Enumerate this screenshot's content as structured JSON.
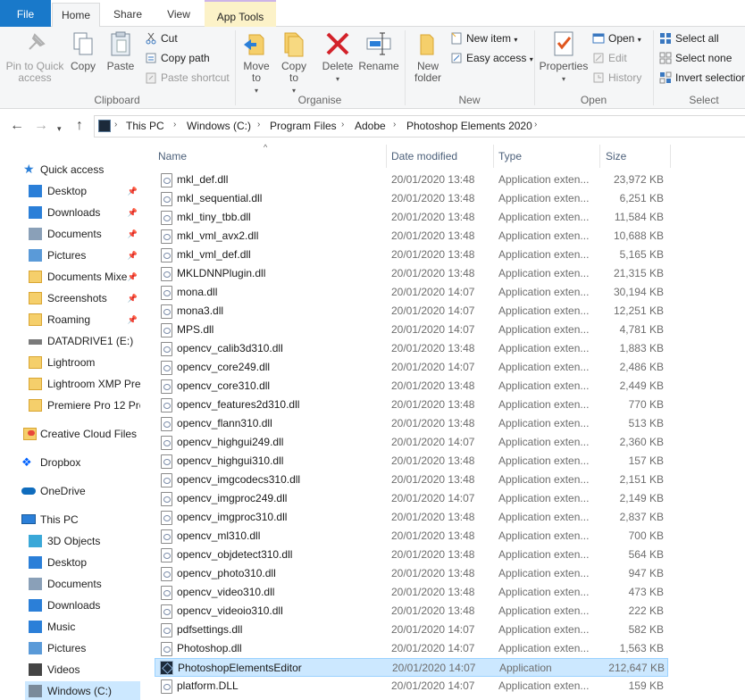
{
  "tabs": {
    "file": "File",
    "home": "Home",
    "share": "Share",
    "view": "View",
    "app_tools": "App Tools"
  },
  "ribbon": {
    "clipboard": {
      "label": "Clipboard",
      "pin": "Pin to Quick access",
      "copy": "Copy",
      "paste": "Paste",
      "cut": "Cut",
      "copy_path": "Copy path",
      "paste_shortcut": "Paste shortcut"
    },
    "organise": {
      "label": "Organise",
      "move_to": "Move to",
      "copy_to": "Copy to",
      "delete": "Delete",
      "rename": "Rename"
    },
    "new": {
      "label": "New",
      "new_folder": "New folder",
      "new_item": "New item",
      "easy_access": "Easy access"
    },
    "open": {
      "label": "Open",
      "properties": "Properties",
      "open": "Open",
      "edit": "Edit",
      "history": "History"
    },
    "select": {
      "label": "Select",
      "select_all": "Select all",
      "select_none": "Select none",
      "invert": "Invert selection"
    }
  },
  "breadcrumb": [
    "This PC",
    "Windows (C:)",
    "Program Files",
    "Adobe",
    "Photoshop Elements 2020"
  ],
  "sidebar": {
    "quick_access": "Quick access",
    "items": [
      {
        "label": "Desktop",
        "icon": "desktop-icon",
        "pinned": true
      },
      {
        "label": "Downloads",
        "icon": "downloads-icon",
        "pinned": true
      },
      {
        "label": "Documents",
        "icon": "documents-icon",
        "pinned": true
      },
      {
        "label": "Pictures",
        "icon": "pictures-icon",
        "pinned": true
      },
      {
        "label": "Documents Mixe",
        "icon": "folder-icon",
        "pinned": true
      },
      {
        "label": "Screenshots",
        "icon": "folder-icon",
        "pinned": true
      },
      {
        "label": "Roaming",
        "icon": "folder-icon",
        "pinned": true
      },
      {
        "label": "DATADRIVE1 (E:)",
        "icon": "drive-icon",
        "pinned": false
      },
      {
        "label": "Lightroom",
        "icon": "folder-icon",
        "pinned": false
      },
      {
        "label": "Lightroom XMP Pre",
        "icon": "folder-icon",
        "pinned": false
      },
      {
        "label": "Premiere Pro 12 Pro",
        "icon": "folder-icon",
        "pinned": false
      }
    ],
    "creative_cloud": "Creative Cloud Files",
    "dropbox": "Dropbox",
    "onedrive": "OneDrive",
    "this_pc": "This PC",
    "pc_items": [
      {
        "label": "3D Objects",
        "icon": "3d-objects-icon"
      },
      {
        "label": "Desktop",
        "icon": "desktop-icon"
      },
      {
        "label": "Documents",
        "icon": "documents-icon"
      },
      {
        "label": "Downloads",
        "icon": "downloads-icon"
      },
      {
        "label": "Music",
        "icon": "music-icon"
      },
      {
        "label": "Pictures",
        "icon": "pictures-icon"
      },
      {
        "label": "Videos",
        "icon": "videos-icon"
      },
      {
        "label": "Windows (C:)",
        "icon": "windows-drive-icon"
      }
    ]
  },
  "columns": {
    "name": "Name",
    "date": "Date modified",
    "type": "Type",
    "size": "Size"
  },
  "files": [
    {
      "name": "mkl_def.dll",
      "date": "20/01/2020 13:48",
      "type": "Application exten...",
      "size": "23,972 KB"
    },
    {
      "name": "mkl_sequential.dll",
      "date": "20/01/2020 13:48",
      "type": "Application exten...",
      "size": "6,251 KB"
    },
    {
      "name": "mkl_tiny_tbb.dll",
      "date": "20/01/2020 13:48",
      "type": "Application exten...",
      "size": "11,584 KB"
    },
    {
      "name": "mkl_vml_avx2.dll",
      "date": "20/01/2020 13:48",
      "type": "Application exten...",
      "size": "10,688 KB"
    },
    {
      "name": "mkl_vml_def.dll",
      "date": "20/01/2020 13:48",
      "type": "Application exten...",
      "size": "5,165 KB"
    },
    {
      "name": "MKLDNNPlugin.dll",
      "date": "20/01/2020 13:48",
      "type": "Application exten...",
      "size": "21,315 KB"
    },
    {
      "name": "mona.dll",
      "date": "20/01/2020 14:07",
      "type": "Application exten...",
      "size": "30,194 KB"
    },
    {
      "name": "mona3.dll",
      "date": "20/01/2020 14:07",
      "type": "Application exten...",
      "size": "12,251 KB"
    },
    {
      "name": "MPS.dll",
      "date": "20/01/2020 14:07",
      "type": "Application exten...",
      "size": "4,781 KB"
    },
    {
      "name": "opencv_calib3d310.dll",
      "date": "20/01/2020 13:48",
      "type": "Application exten...",
      "size": "1,883 KB"
    },
    {
      "name": "opencv_core249.dll",
      "date": "20/01/2020 14:07",
      "type": "Application exten...",
      "size": "2,486 KB"
    },
    {
      "name": "opencv_core310.dll",
      "date": "20/01/2020 13:48",
      "type": "Application exten...",
      "size": "2,449 KB"
    },
    {
      "name": "opencv_features2d310.dll",
      "date": "20/01/2020 13:48",
      "type": "Application exten...",
      "size": "770 KB"
    },
    {
      "name": "opencv_flann310.dll",
      "date": "20/01/2020 13:48",
      "type": "Application exten...",
      "size": "513 KB"
    },
    {
      "name": "opencv_highgui249.dll",
      "date": "20/01/2020 14:07",
      "type": "Application exten...",
      "size": "2,360 KB"
    },
    {
      "name": "opencv_highgui310.dll",
      "date": "20/01/2020 13:48",
      "type": "Application exten...",
      "size": "157 KB"
    },
    {
      "name": "opencv_imgcodecs310.dll",
      "date": "20/01/2020 13:48",
      "type": "Application exten...",
      "size": "2,151 KB"
    },
    {
      "name": "opencv_imgproc249.dll",
      "date": "20/01/2020 14:07",
      "type": "Application exten...",
      "size": "2,149 KB"
    },
    {
      "name": "opencv_imgproc310.dll",
      "date": "20/01/2020 13:48",
      "type": "Application exten...",
      "size": "2,837 KB"
    },
    {
      "name": "opencv_ml310.dll",
      "date": "20/01/2020 13:48",
      "type": "Application exten...",
      "size": "700 KB"
    },
    {
      "name": "opencv_objdetect310.dll",
      "date": "20/01/2020 13:48",
      "type": "Application exten...",
      "size": "564 KB"
    },
    {
      "name": "opencv_photo310.dll",
      "date": "20/01/2020 13:48",
      "type": "Application exten...",
      "size": "947 KB"
    },
    {
      "name": "opencv_video310.dll",
      "date": "20/01/2020 13:48",
      "type": "Application exten...",
      "size": "473 KB"
    },
    {
      "name": "opencv_videoio310.dll",
      "date": "20/01/2020 13:48",
      "type": "Application exten...",
      "size": "222 KB"
    },
    {
      "name": "pdfsettings.dll",
      "date": "20/01/2020 14:07",
      "type": "Application exten...",
      "size": "582 KB"
    },
    {
      "name": "Photoshop.dll",
      "date": "20/01/2020 14:07",
      "type": "Application exten...",
      "size": "1,563 KB"
    },
    {
      "name": "PhotoshopElementsEditor",
      "date": "20/01/2020 14:07",
      "type": "Application",
      "size": "212,647 KB",
      "selected": true,
      "app": true
    },
    {
      "name": "platform.DLL",
      "date": "20/01/2020 14:07",
      "type": "Application exten...",
      "size": "159 KB"
    }
  ]
}
